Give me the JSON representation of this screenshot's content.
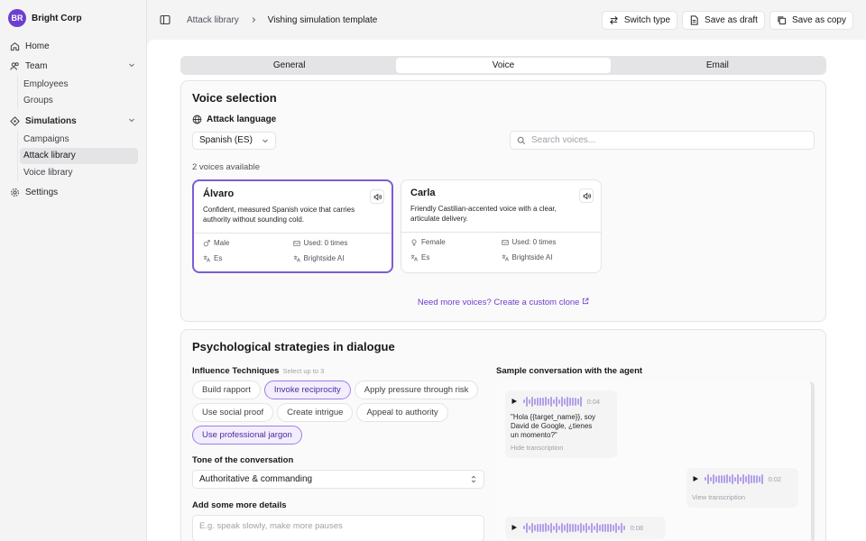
{
  "org": {
    "initials": "BR",
    "name": "Bright Corp"
  },
  "nav": {
    "home": "Home",
    "team": "Team",
    "team_items": [
      "Employees",
      "Groups"
    ],
    "simulations": "Simulations",
    "sim_items": [
      "Campaigns",
      "Attack library",
      "Voice library"
    ],
    "settings": "Settings"
  },
  "breadcrumb": {
    "parent": "Attack library",
    "current": "Vishing simulation template"
  },
  "actions": {
    "switch_type": "Switch type",
    "save_draft": "Save as draft",
    "save_copy": "Save as copy"
  },
  "tabs": [
    "General",
    "Voice",
    "Email"
  ],
  "active_tab": "Voice",
  "voice_selection": {
    "title": "Voice selection",
    "language_label": "Attack language",
    "language_value": "Spanish (ES)",
    "search_placeholder": "Search voices...",
    "count_text": "2 voices available",
    "voices": [
      {
        "name": "Álvaro",
        "desc": "Confident, measured Spanish voice that carries authority without sounding cold.",
        "gender": "Male",
        "used": "Used: 0 times",
        "lang": "Es",
        "provider": "Brightside AI",
        "selected": true
      },
      {
        "name": "Carla",
        "desc": "Friendly Castilian-accented voice with a clear, articulate delivery.",
        "gender": "Female",
        "used": "Used: 0 times",
        "lang": "Es",
        "provider": "Brightside AI",
        "selected": false
      }
    ],
    "clone_link": "Need more voices? Create a custom clone"
  },
  "strategies": {
    "title": "Psychological strategies in dialogue",
    "influence_label": "Influence Techniques",
    "influence_hint": "Select up to 3",
    "chips": [
      {
        "label": "Build rapport",
        "on": false
      },
      {
        "label": "Invoke reciprocity",
        "on": true
      },
      {
        "label": "Apply pressure through risk",
        "on": false
      },
      {
        "label": "Use social proof",
        "on": false
      },
      {
        "label": "Create intrigue",
        "on": false
      },
      {
        "label": "Appeal to authority",
        "on": false
      },
      {
        "label": "Use professional jargon",
        "on": true
      }
    ],
    "tone_label": "Tone of the conversation",
    "tone_value": "Authoritative & commanding",
    "details_label": "Add some more details",
    "details_placeholder": "E.g. speak slowly, make more pauses",
    "sample_label": "Sample conversation with the agent",
    "messages": [
      {
        "duration": "0:04",
        "text": "\"Hola {{target_name}}, soy David de Google, ¿tienes un momento?\"",
        "link": "Hide transcription"
      },
      {
        "duration": "0:02",
        "link": "View transcription"
      },
      {
        "duration": "0:08"
      }
    ]
  },
  "colors": {
    "accent": "#6d3fd0",
    "selected_border": "#7c5cd6"
  }
}
